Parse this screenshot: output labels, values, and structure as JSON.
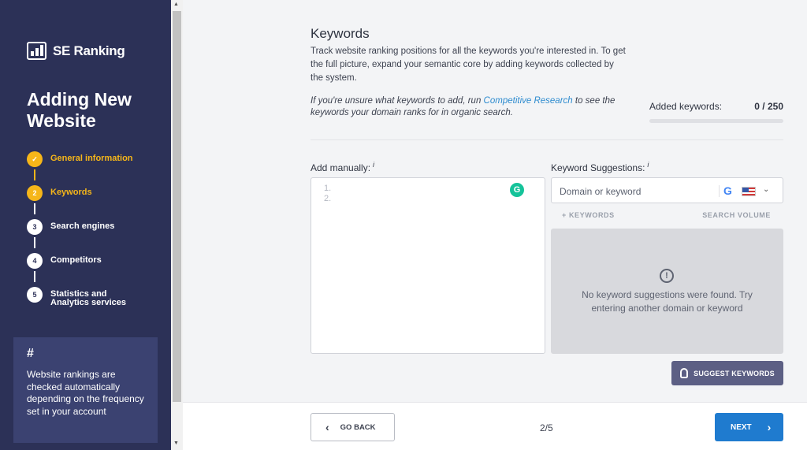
{
  "sidebar": {
    "logo_text": "SE Ranking",
    "title": "Adding New Website",
    "steps": [
      {
        "num": "✓",
        "label": "General information",
        "state": "done"
      },
      {
        "num": "2",
        "label": "Keywords",
        "state": "active"
      },
      {
        "num": "3",
        "label": "Search engines",
        "state": "pending"
      },
      {
        "num": "4",
        "label": "Competitors",
        "state": "pending"
      },
      {
        "num": "5",
        "label": "Statistics and Analytics services",
        "state": "pending"
      }
    ],
    "info": {
      "hash": "#",
      "text": "Website rankings are checked automatically depending on the frequency set in your account"
    }
  },
  "keywords": {
    "title": "Keywords",
    "description": "Track website ranking positions for all the keywords you're interested in. To get the full picture, expand your semantic core by adding keywords collected by the system.",
    "note_before": "If you're unsure what keywords to add, run ",
    "note_link": "Competitive Research",
    "note_after": " to see the keywords your domain ranks for in organic search.",
    "added_label": "Added keywords:",
    "added_value": "0 / 250",
    "added_fraction": 0
  },
  "manual": {
    "label": "Add manually:",
    "info": "i",
    "lines": [
      "1.",
      "2."
    ]
  },
  "suggestions": {
    "label": "Keyword Suggestions:",
    "info": "i",
    "placeholder": "Domain or keyword",
    "col_keywords": "+ KEYWORDS",
    "col_volume": "SEARCH VOLUME",
    "empty_message": "No keyword suggestions were found. Try entering another domain or keyword",
    "suggest_button": "SUGGEST KEYWORDS"
  },
  "footer": {
    "back_label": "GO BACK",
    "pager": "2/5",
    "next_label": "NEXT"
  },
  "colors": {
    "sidebar_bg": "#2c3157",
    "accent": "#f6b619",
    "primary": "#1f7bcf",
    "link": "#2d8bcf"
  }
}
